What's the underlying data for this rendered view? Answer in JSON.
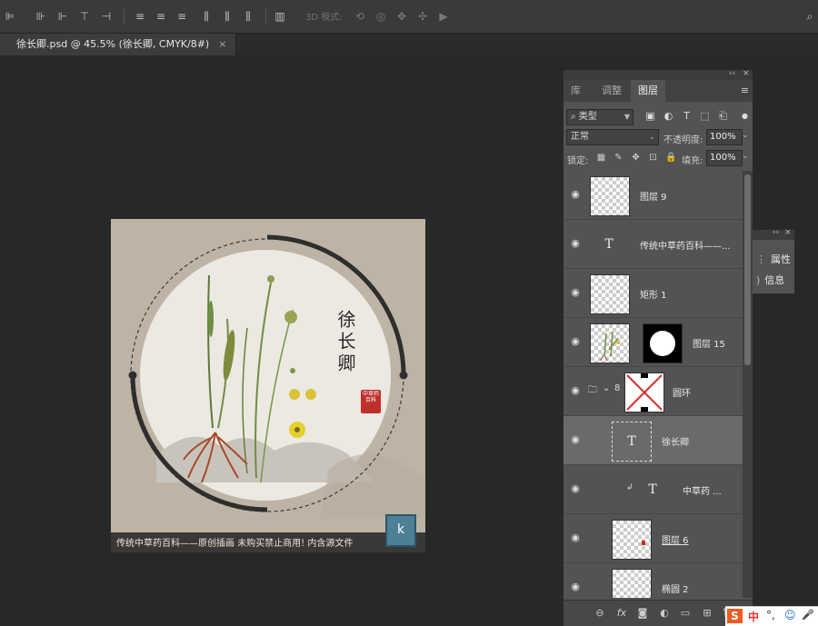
{
  "options_bar": {
    "mode_3d_label": "3D 模式:",
    "icons": [
      "align-left-icon",
      "align-hcenter-icon",
      "align-right-icon",
      "align-top-icon",
      "align-vcenter-icon",
      "align-bottom-icon",
      "distribute-top-icon",
      "distribute-vcenter-icon",
      "distribute-bottom-icon",
      "distribute-left-icon",
      "distribute-hcenter-icon",
      "distribute-right-icon",
      "auto-align-icon",
      "orbit-3d-icon",
      "roll-3d-icon",
      "pan-3d-icon",
      "slide-3d-icon",
      "scale-3d-icon"
    ]
  },
  "document_tab": {
    "title": "徐长卿.psd @ 45.5% (徐长卿, CMYK/8#)",
    "close": "×"
  },
  "canvas": {
    "title_text": "徐长卿",
    "seal_text": "中草药百科",
    "footer_text": "传统中草药百科——原创插画 未购买禁止商用! 内含源文件",
    "watermark_text": "k"
  },
  "panel": {
    "collapse": "‹‹",
    "close": "×",
    "tabs": [
      {
        "label": "库",
        "active": false
      },
      {
        "label": "调整",
        "active": false
      },
      {
        "label": "图层",
        "active": true
      }
    ],
    "menu_icon": "≡",
    "filter": {
      "label": "类型",
      "search_icon": "⌕"
    },
    "blend_mode": "正常",
    "opacity_label": "不透明度:",
    "opacity_value": "100%",
    "lock_label": "锁定:",
    "fill_label": "填充:",
    "fill_value": "100%"
  },
  "layers": [
    {
      "name": "图层 9",
      "kind": "pixel",
      "selected": false
    },
    {
      "name": "传统中草药百科——...",
      "kind": "text",
      "selected": false
    },
    {
      "name": "矩形 1",
      "kind": "shape",
      "selected": false
    },
    {
      "name": "图层 15",
      "kind": "masked",
      "selected": false
    },
    {
      "name": "圆环",
      "kind": "group",
      "selected": false
    },
    {
      "name": "徐长卿",
      "kind": "text",
      "selected": true
    },
    {
      "name": "中草药 ...",
      "kind": "text",
      "selected": false
    },
    {
      "name": "图层 6",
      "kind": "pixel",
      "selected": false
    },
    {
      "name": "椭圆 2",
      "kind": "shape",
      "selected": false
    }
  ],
  "text_layer_glyph": "T",
  "properties_panel": {
    "collapse": "››",
    "close": "×",
    "items": [
      "属性",
      "信息"
    ]
  },
  "ime_bar": {
    "logo": "S",
    "lang": "中",
    "punct": "°,",
    "emoji": "☺",
    "mic": "🎤"
  },
  "colors": {
    "app_bg": "#282828",
    "panel_bg": "#535353",
    "selected_layer": "#6a6a6a",
    "canvas_bg": "#bdb4a6",
    "seal_red": "#c0302a"
  }
}
